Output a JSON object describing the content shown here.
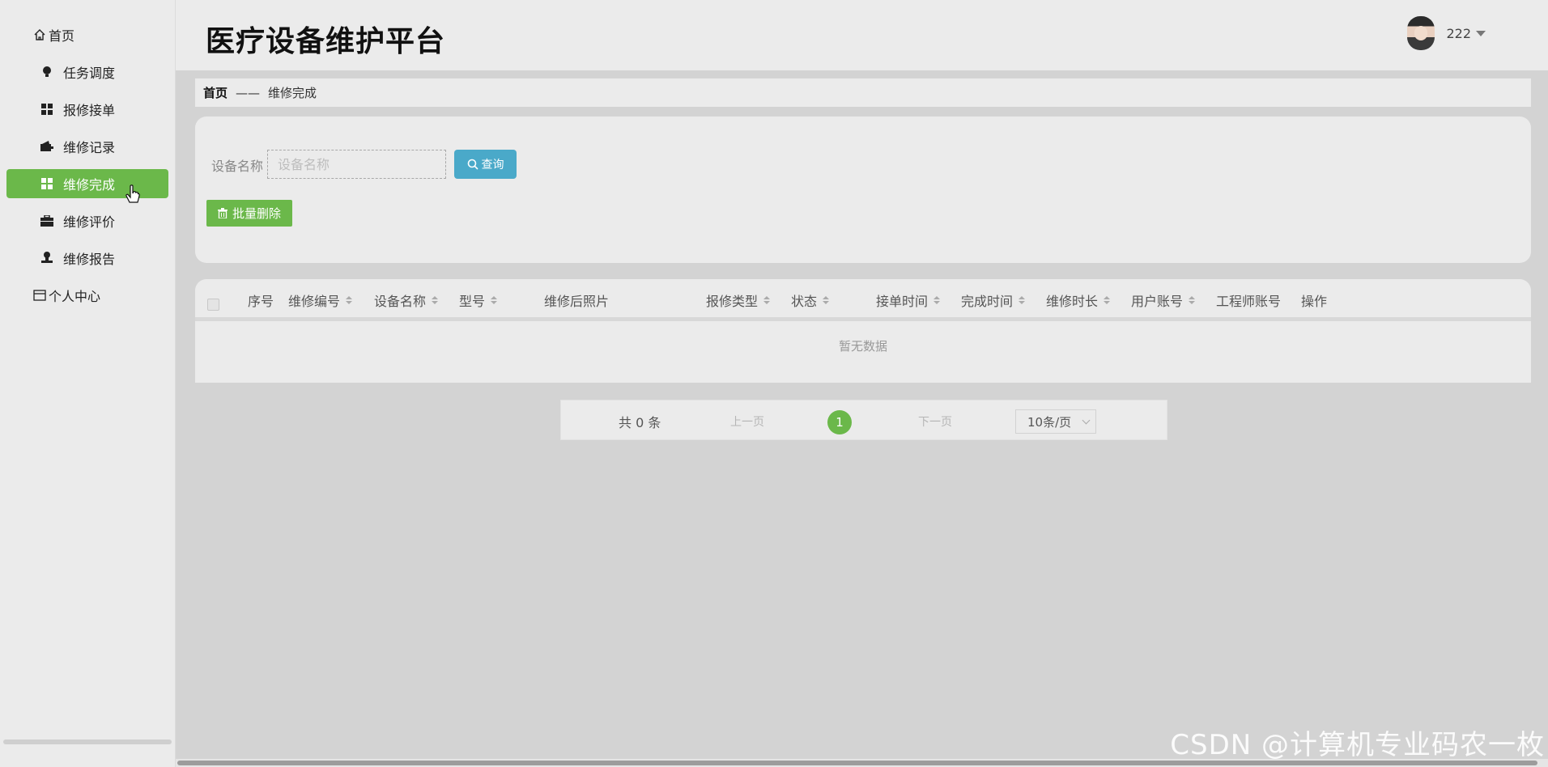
{
  "app": {
    "title": "医疗设备维护平台"
  },
  "user": {
    "name": "222"
  },
  "sidebar": {
    "items": [
      {
        "label": "首页",
        "icon": "home-icon"
      },
      {
        "label": "任务调度",
        "icon": "lightbulb-icon"
      },
      {
        "label": "报修接单",
        "icon": "grid-icon"
      },
      {
        "label": "维修记录",
        "icon": "wallet-icon"
      },
      {
        "label": "维修完成",
        "icon": "grid-icon",
        "active": true
      },
      {
        "label": "维修评价",
        "icon": "briefcase-icon"
      },
      {
        "label": "维修报告",
        "icon": "stamp-icon"
      },
      {
        "label": "个人中心",
        "icon": "window-icon"
      }
    ]
  },
  "breadcrumb": {
    "home": "首页",
    "separator": "——",
    "current": "维修完成"
  },
  "search": {
    "label": "设备名称",
    "placeholder": "设备名称",
    "value": "",
    "button_label": "查询"
  },
  "actions": {
    "batch_delete_label": "批量删除"
  },
  "table": {
    "columns": [
      "序号",
      "维修编号",
      "设备名称",
      "型号",
      "维修后照片",
      "报修类型",
      "状态",
      "接单时间",
      "完成时间",
      "维修时长",
      "用户账号",
      "工程师账号",
      "操作"
    ],
    "rows": [],
    "empty_text": "暂无数据"
  },
  "pagination": {
    "total_text": "共 0 条",
    "prev_label": "上一页",
    "current_page": "1",
    "next_label": "下一页",
    "page_size": "10条/页"
  },
  "watermark": "CSDN @计算机专业码农一枚",
  "colors": {
    "accent": "#6bb84a",
    "search_button": "#4aa9c9"
  }
}
